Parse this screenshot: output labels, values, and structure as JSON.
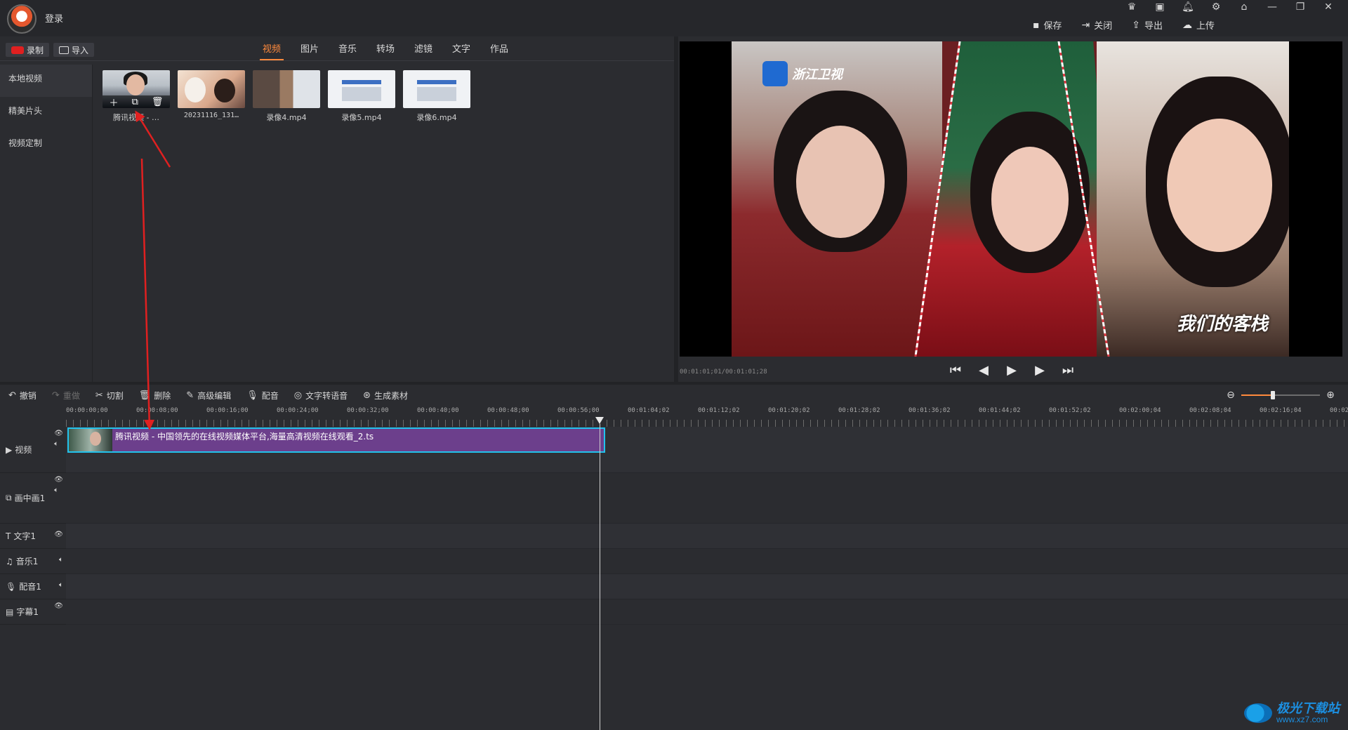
{
  "titlebar": {
    "login": "登录",
    "window_icons": [
      "crown-icon",
      "player-icon",
      "bell-icon",
      "gear-icon",
      "home-icon",
      "minimize-icon",
      "restore-icon",
      "close-icon"
    ],
    "actions": [
      {
        "label": "保存",
        "icon": "save-icon"
      },
      {
        "label": "关闭",
        "icon": "close-project-icon"
      },
      {
        "label": "导出",
        "icon": "export-icon"
      },
      {
        "label": "上传",
        "icon": "upload-icon"
      }
    ]
  },
  "record_bar": {
    "record": "录制",
    "import": "导入"
  },
  "tabs": [
    "视频",
    "图片",
    "音乐",
    "转场",
    "滤镜",
    "文字",
    "作品"
  ],
  "active_tab": 0,
  "sidebar": {
    "items": [
      {
        "label": "本地视频"
      },
      {
        "label": "精美片头"
      },
      {
        "label": "视频定制"
      }
    ],
    "active": 0
  },
  "media": [
    {
      "label": "腾讯视频 - …"
    },
    {
      "label": "20231116_131…"
    },
    {
      "label": "录像4.mp4"
    },
    {
      "label": "录像5.mp4"
    },
    {
      "label": "录像6.mp4"
    }
  ],
  "preview": {
    "brand": "浙江卫视",
    "show_logo": "我们的客栈",
    "time": "00:01:01;01/00:01:01;28"
  },
  "timeline_toolbar": [
    {
      "label": "撤销",
      "icon": "undo-icon",
      "enabled": true
    },
    {
      "label": "重做",
      "icon": "redo-icon",
      "enabled": false
    },
    {
      "label": "切割",
      "icon": "scissors-icon",
      "enabled": true
    },
    {
      "label": "删除",
      "icon": "trash-icon",
      "enabled": true
    },
    {
      "label": "高级编辑",
      "icon": "pencil-icon",
      "enabled": true
    },
    {
      "label": "配音",
      "icon": "microphone-icon",
      "enabled": true
    },
    {
      "label": "文字转语音",
      "icon": "tts-icon",
      "enabled": true
    },
    {
      "label": "生成素材",
      "icon": "generate-icon",
      "enabled": true
    }
  ],
  "zoom_level": 0.4,
  "ruler_labels": [
    "00:00:00;00",
    "00:00:08;00",
    "00:00:16;00",
    "00:00:24;00",
    "00:00:32;00",
    "00:00:40;00",
    "00:00:48;00",
    "00:00:56;00",
    "00:01:04;02",
    "00:01:12;02",
    "00:01:20;02",
    "00:01:28;02",
    "00:01:36;02",
    "00:01:44;02",
    "00:01:52;02",
    "00:02:00;04",
    "00:02:08;04",
    "00:02:16;04",
    "00:02:2"
  ],
  "tracks": [
    {
      "label": "视频",
      "icon": "video-track-icon"
    },
    {
      "label": "画中画1",
      "icon": "pip-track-icon"
    },
    {
      "label": "文字1",
      "icon": "text-track-icon"
    },
    {
      "label": "音乐1",
      "icon": "music-track-icon"
    },
    {
      "label": "配音1",
      "icon": "mic-track-icon"
    },
    {
      "label": "字幕1",
      "icon": "subtitle-track-icon"
    }
  ],
  "clip": {
    "title": "腾讯视频 - 中国领先的在线视频媒体平台,海量高清视频在线观看_2.ts"
  },
  "watermark": {
    "line1": "极光下载站",
    "line2": "www.xz7.com"
  },
  "colors": {
    "accent": "#ff8a3d",
    "clip": "#6c3f8c",
    "clip_border": "#22c2ec",
    "annotation": "#e02020"
  }
}
